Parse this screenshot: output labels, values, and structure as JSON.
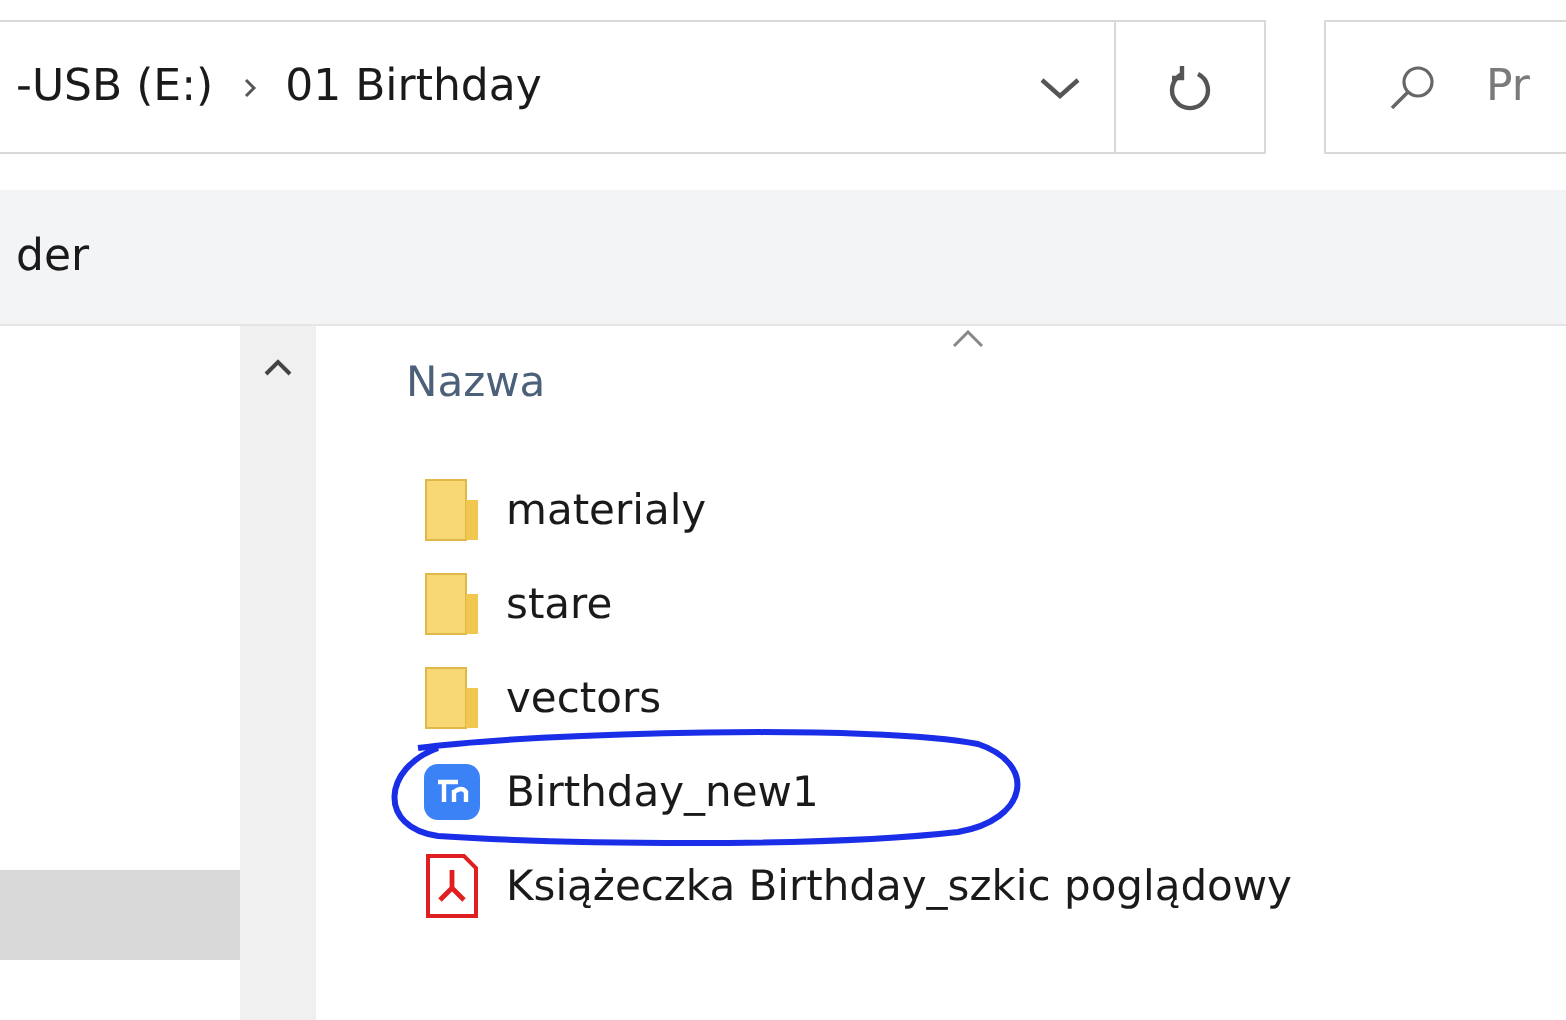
{
  "address_bar": {
    "segments": [
      {
        "label": "-USB (E:)"
      },
      {
        "label": "01 Birthday"
      }
    ]
  },
  "search": {
    "placeholder": "Pr"
  },
  "ribbon": {
    "label": "der"
  },
  "file_list": {
    "column_header": "Nazwa",
    "items": [
      {
        "name": "materialy",
        "kind": "folder",
        "annotated": false
      },
      {
        "name": "stare",
        "kind": "folder",
        "annotated": false
      },
      {
        "name": "vectors",
        "kind": "folder",
        "annotated": false
      },
      {
        "name": "Birthday_new1",
        "kind": "app",
        "annotated": true
      },
      {
        "name": "Książeczka Birthday_szkic poglądowy",
        "kind": "pdf",
        "annotated": false
      }
    ]
  }
}
